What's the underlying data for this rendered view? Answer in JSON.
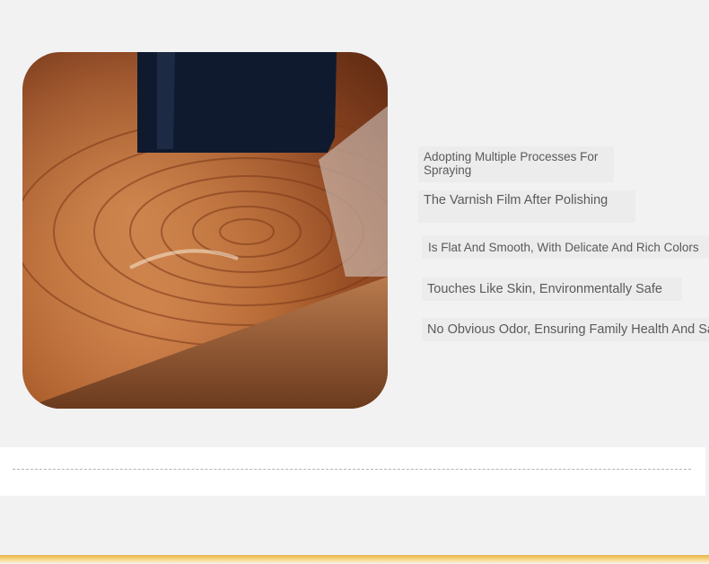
{
  "captions": [
    "Adopting Multiple Processes For Spraying",
    "The Varnish Film After Polishing",
    "Is Flat And Smooth, With Delicate And Rich Colors",
    "Touches Like Skin, Environmentally Safe",
    "No Obvious Odor, Ensuring Family Health And Safety"
  ],
  "colors": {
    "background": "#f2f2f3",
    "wood": "#b0622f",
    "brush": "#0f1a2e",
    "accent_band": "#e9b34a"
  },
  "icons": {
    "photo": "varnished-wood-brush-photo"
  }
}
